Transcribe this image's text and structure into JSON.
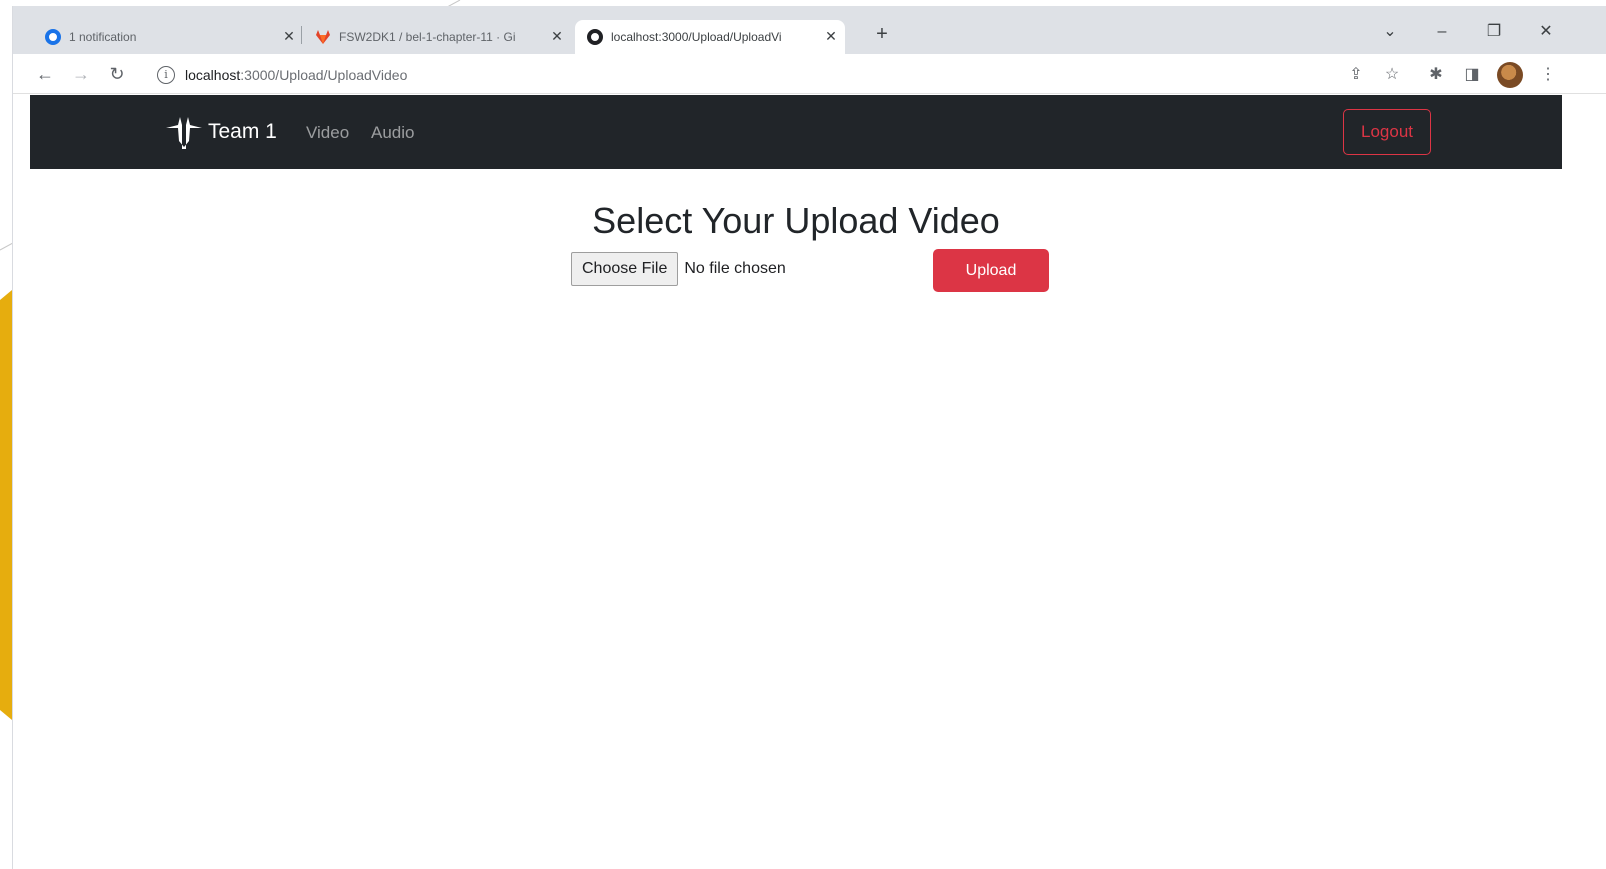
{
  "browser": {
    "tabs": [
      {
        "title": "1 notification",
        "icon": "notification-favicon",
        "color": "#1a73e8"
      },
      {
        "title": "FSW2DK1 / bel-1-chapter-11 · Gi",
        "icon": "gitlab-favicon",
        "color": "#e24329"
      },
      {
        "title": "localhost:3000/Upload/UploadVi",
        "icon": "page-favicon",
        "color": "#202124"
      }
    ],
    "new_tab": "+",
    "address": {
      "host": "localhost",
      "rest": ":3000/Upload/UploadVideo"
    }
  },
  "app": {
    "brand": "Team 1",
    "nav": [
      {
        "label": "Video"
      },
      {
        "label": "Audio"
      }
    ],
    "logout_label": "Logout"
  },
  "main": {
    "title": "Select Your Upload Video",
    "choose_file_label": "Choose File",
    "no_file_label": "No file chosen",
    "upload_label": "Upload"
  },
  "colors": {
    "navbar": "#212529",
    "danger": "#dc3545",
    "slide_accent": "#e6ad0e"
  }
}
